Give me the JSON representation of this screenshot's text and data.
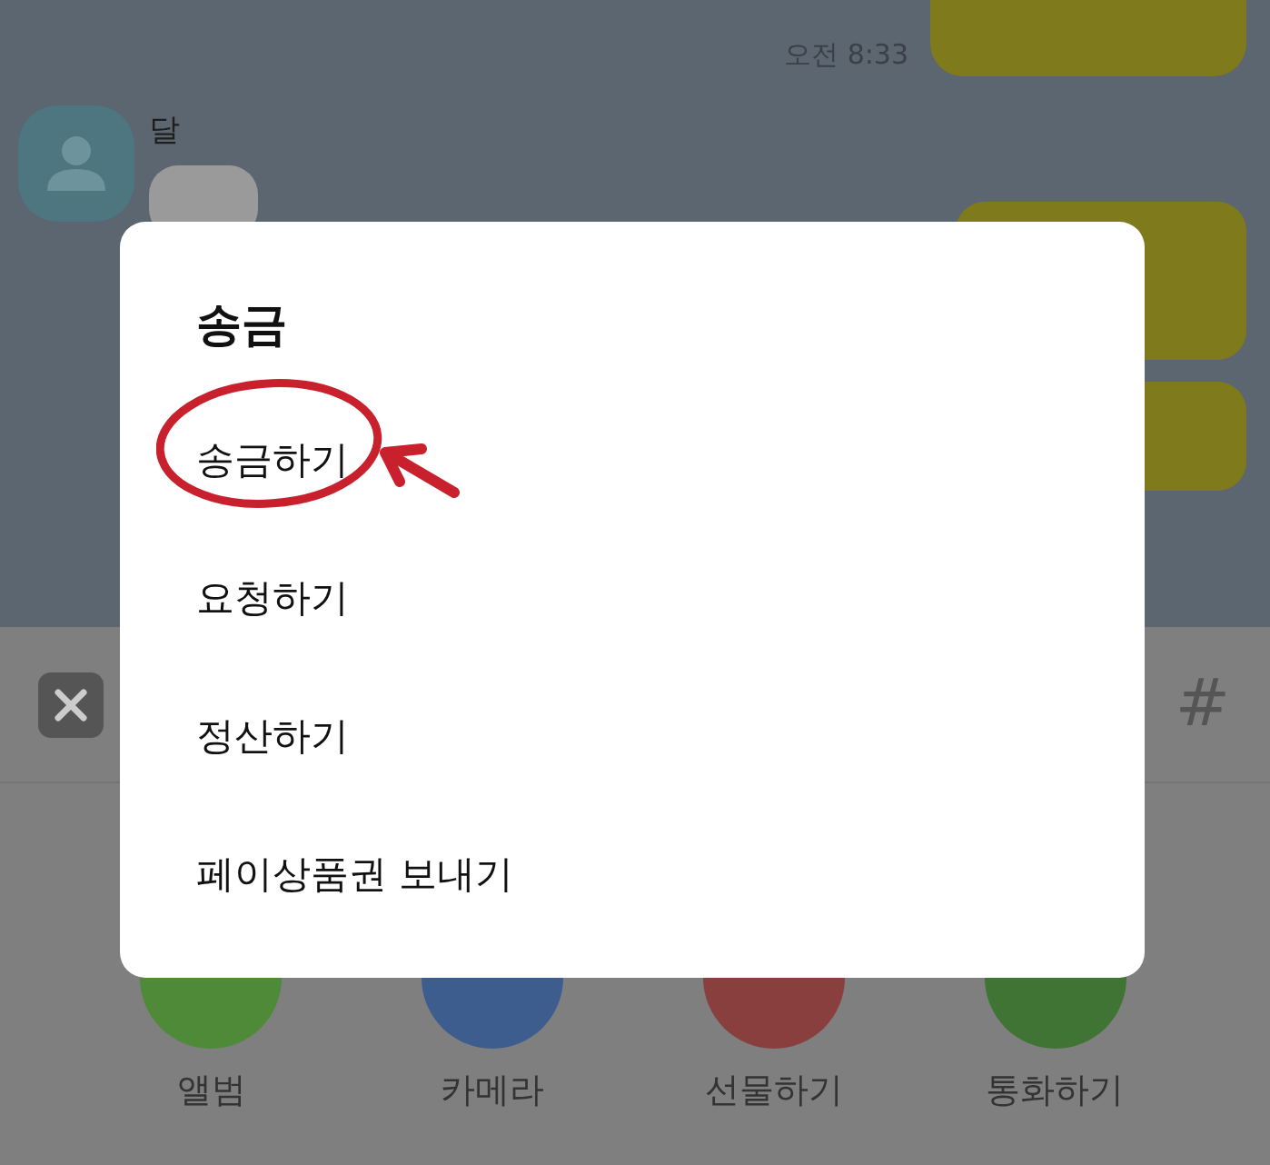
{
  "chat": {
    "time": "오전 8:33",
    "sender": "달"
  },
  "toolbar": {
    "hash": "#"
  },
  "attachments": [
    {
      "label": "앨범",
      "color": "#4e8a38"
    },
    {
      "label": "카메라",
      "color": "#3e5d8f"
    },
    {
      "label": "선물하기",
      "color": "#8a3f3f"
    },
    {
      "label": "통화하기",
      "color": "#3f7434"
    }
  ],
  "dialog": {
    "title": "송금",
    "items": [
      {
        "label": "송금하기",
        "highlighted": true
      },
      {
        "label": "요청하기",
        "highlighted": false
      },
      {
        "label": "정산하기",
        "highlighted": false
      },
      {
        "label": "페이상품권 보내기",
        "highlighted": false
      }
    ]
  }
}
